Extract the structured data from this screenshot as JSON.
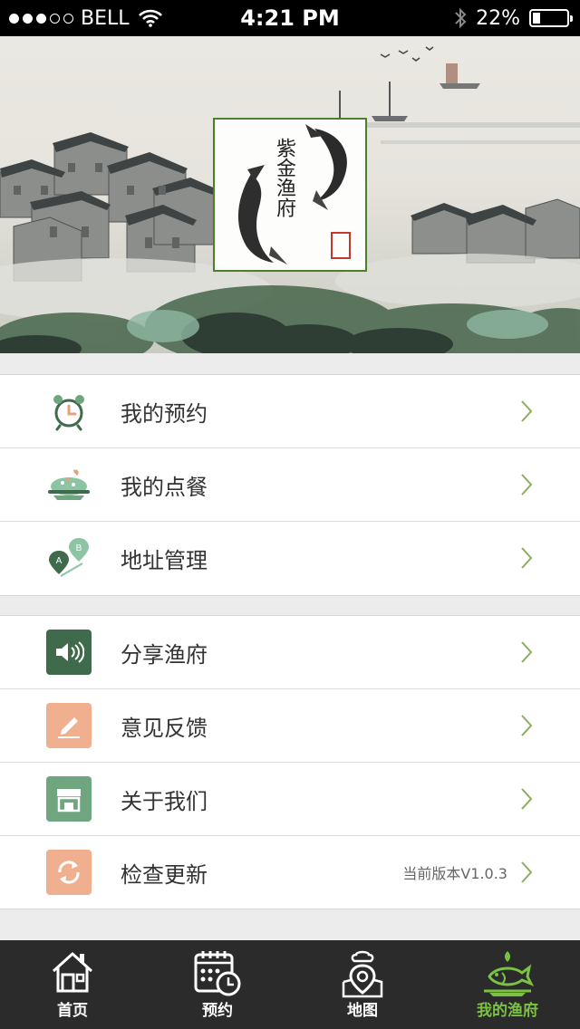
{
  "status_bar": {
    "carrier": "BELL",
    "time": "4:21 PM",
    "battery_percent": "22%",
    "battery_level": 0.22,
    "signal_bars": 3
  },
  "banner": {
    "logo_text": "紫金渔府"
  },
  "menu_group_1": [
    {
      "label": "我的预约",
      "icon": "alarm-clock-icon"
    },
    {
      "label": "我的点餐",
      "icon": "dish-icon"
    },
    {
      "label": "地址管理",
      "icon": "map-route-icon"
    }
  ],
  "menu_group_2": [
    {
      "label": "分享渔府",
      "icon": "speaker-icon",
      "color": "#3f6b4c"
    },
    {
      "label": "意见反馈",
      "icon": "edit-icon",
      "color": "#f0b08f"
    },
    {
      "label": "关于我们",
      "icon": "store-icon",
      "color": "#6fa57f"
    },
    {
      "label": "检查更新",
      "icon": "refresh-icon",
      "color": "#f0b08f",
      "detail": "当前版本V1.0.3"
    }
  ],
  "tab_bar": {
    "items": [
      {
        "label": "首页",
        "icon": "home-icon"
      },
      {
        "label": "预约",
        "icon": "calendar-clock-icon"
      },
      {
        "label": "地图",
        "icon": "map-pin-icon"
      },
      {
        "label": "我的渔府",
        "icon": "fish-dish-icon",
        "active": true
      }
    ],
    "active_color": "#7bc142"
  }
}
